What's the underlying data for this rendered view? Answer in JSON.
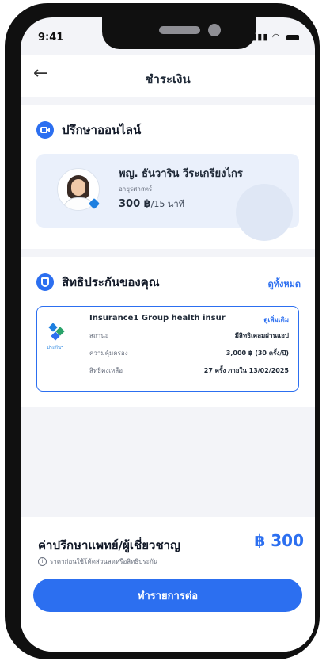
{
  "status_bar": {
    "time": "9:41"
  },
  "header": {
    "title": "ชำระเงิน"
  },
  "consult": {
    "section_title": "ปรึกษาออนไลน์",
    "doctor": {
      "name": "พญ. ธันวาริน วีระเกรียงไกร",
      "specialty": "อายุรศาสตร์",
      "price": "300 ฿",
      "unit": "/15 นาที"
    }
  },
  "rights": {
    "section_title": "สิทธิประกันของคุณ",
    "see_all": "ดูทั้งหมด",
    "insurance": {
      "logo_text": "ประกันฯ",
      "name": "Insurance1 Group health insur",
      "detail_link": "ดูเพิ่มเติม",
      "rows": [
        {
          "label": "สถานะ",
          "value": "มีสิทธิเคลมผ่านแอป"
        },
        {
          "label": "ความคุ้มครอง",
          "value": "3,000 ฿ (30 ครั้ง/ปี)"
        },
        {
          "label": "สิทธิคงเหลือ",
          "value": "27 ครั้ง ภายใน 13/02/2025"
        }
      ]
    }
  },
  "footer": {
    "fee_label": "ค่าปรึกษาแพทย์/ผู้เชี่ยวชาญ",
    "fee_note": "ราคาก่อนใช้โค้ดส่วนลดหรือสิทธิประกัน",
    "fee_amount": "฿ 300",
    "cta_label": "ทำรายการต่อ"
  },
  "colors": {
    "accent": "#2c6ff0",
    "background": "#f3f4f8"
  }
}
